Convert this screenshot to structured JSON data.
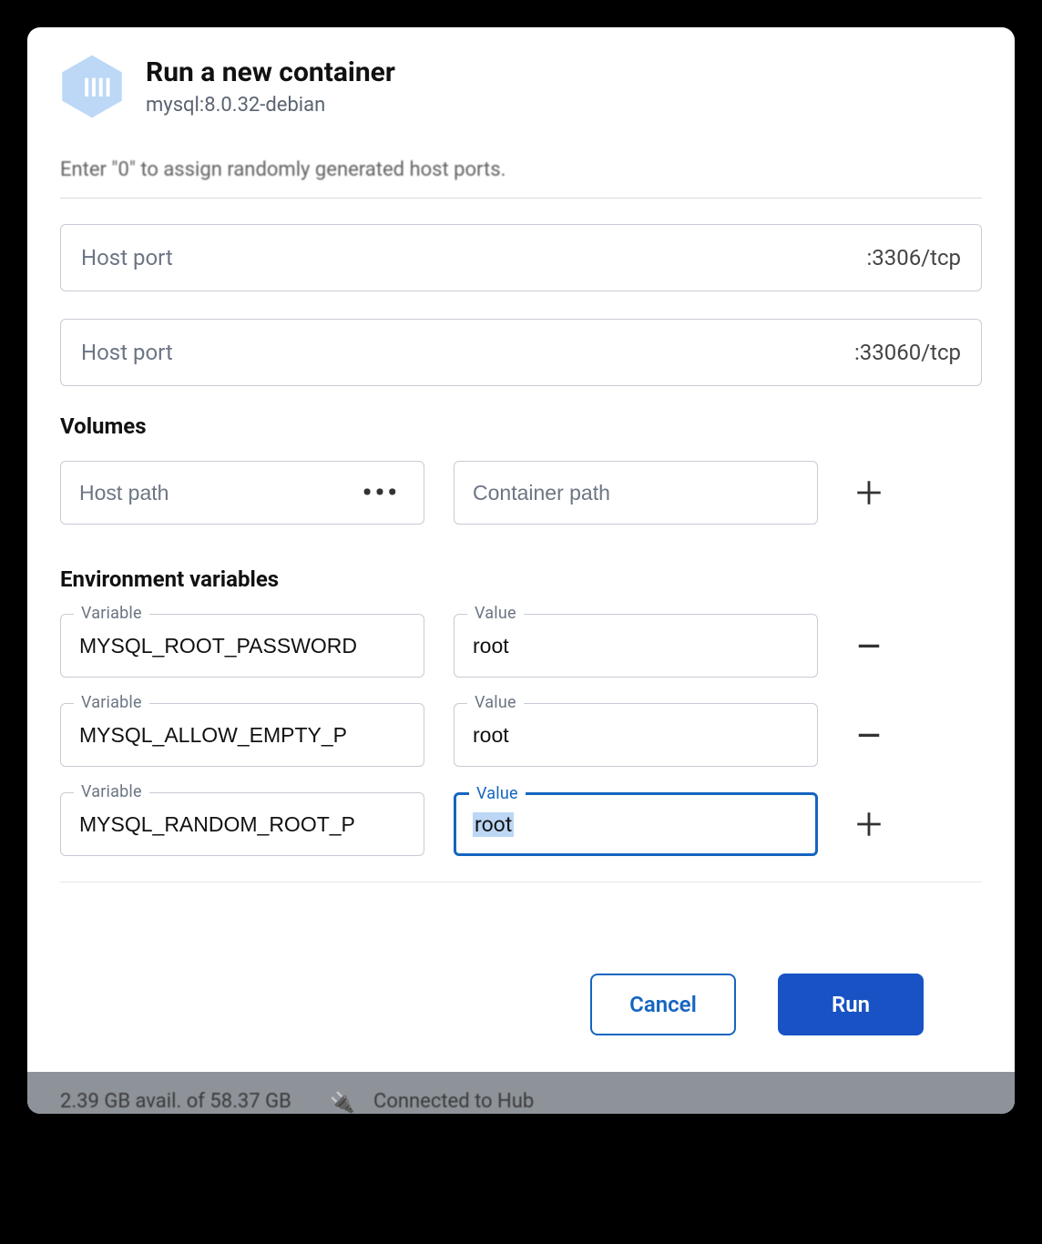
{
  "header": {
    "title": "Run a new container",
    "subtitle": "mysql:8.0.32-debian"
  },
  "ports": {
    "cutoff_hint": "Enter \"0\" to assign randomly generated host ports.",
    "rows": [
      {
        "placeholder": "Host port",
        "suffix": ":3306/tcp"
      },
      {
        "placeholder": "Host port",
        "suffix": ":33060/tcp"
      }
    ]
  },
  "volumes": {
    "heading": "Volumes",
    "host_placeholder": "Host path",
    "container_placeholder": "Container path"
  },
  "env": {
    "heading": "Environment variables",
    "variable_label": "Variable",
    "value_label": "Value",
    "rows": [
      {
        "variable": "MYSQL_ROOT_PASSWORD",
        "value": "root",
        "action": "remove"
      },
      {
        "variable": "MYSQL_ALLOW_EMPTY_P",
        "value": "root",
        "action": "remove"
      },
      {
        "variable": "MYSQL_RANDOM_ROOT_P",
        "value": "root",
        "action": "add",
        "value_focused": true,
        "value_selected": true
      }
    ]
  },
  "footer": {
    "cancel": "Cancel",
    "run": "Run"
  },
  "statusbar": {
    "disk": "2.39 GB avail. of 58.37 GB",
    "hub": "Connected to Hub"
  }
}
